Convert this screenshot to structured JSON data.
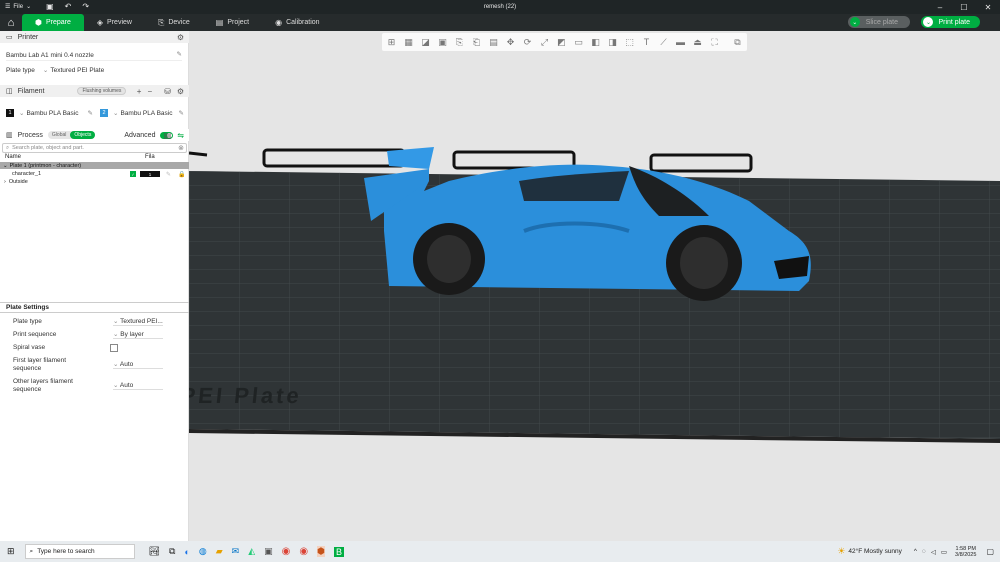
{
  "titlebar": {
    "file_label": "File",
    "title": "remesh (22)"
  },
  "tabs": [
    {
      "label": "Prepare"
    },
    {
      "label": "Preview"
    },
    {
      "label": "Device"
    },
    {
      "label": "Project"
    },
    {
      "label": "Calibration"
    }
  ],
  "actions": {
    "slice": "Slice plate",
    "print": "Print plate"
  },
  "printer": {
    "header": "Printer",
    "name": "Bambu Lab A1 mini 0.4 nozzle",
    "plate_type_label": "Plate type",
    "plate_type_value": "Textured PEI Plate"
  },
  "filament": {
    "header": "Filament",
    "flushing": "Flushing volumes",
    "items": [
      {
        "index": "1",
        "name": "Bambu PLA Basic",
        "color": "#111111"
      },
      {
        "index": "2",
        "name": "Bambu PLA Basic",
        "color": "#3498db"
      }
    ]
  },
  "process": {
    "header": "Process",
    "global": "Global",
    "objects": "Objects",
    "advanced": "Advanced"
  },
  "search": {
    "placeholder": "Search plate, object and part."
  },
  "tree": {
    "col_name": "Name",
    "col_fila": "Fila",
    "plate": "Plate 1 (printmon - character)",
    "object": "character_1",
    "object_fila": "1",
    "outside": "Outside"
  },
  "plate_settings": {
    "header": "Plate Settings",
    "rows": [
      {
        "label": "Plate type",
        "value": "Textured PEI..."
      },
      {
        "label": "Print sequence",
        "value": "By layer"
      },
      {
        "label": "Spiral vase",
        "value": ""
      },
      {
        "label": "First layer filament sequence",
        "value": "Auto"
      },
      {
        "label": "Other layers filament sequence",
        "value": "Auto"
      }
    ]
  },
  "bed": {
    "text": "PEI Plate"
  },
  "taskbar": {
    "search_placeholder": "Type here to search",
    "weather": "42°F  Mostly sunny",
    "time": "1:58 PM",
    "date": "3/8/2025"
  },
  "colors": {
    "accent": "#00ae42",
    "model": "#2b8fdb",
    "bed": "#2f3436",
    "background": "#e5e5e5"
  }
}
